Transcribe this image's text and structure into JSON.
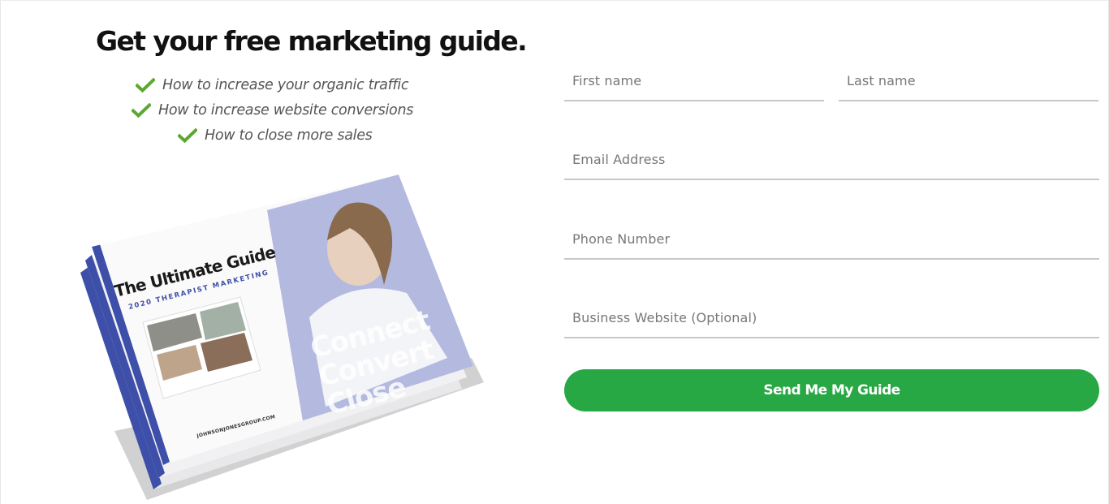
{
  "headline": "Get your free marketing guide.",
  "bullets": [
    "How to increase your organic traffic",
    "How to increase website conversions",
    "How to close more sales"
  ],
  "guide": {
    "title": "The Ultimate Guide",
    "subtitle": "2020 THERAPIST MARKETING",
    "website": "JOHNSONJONESGROUP.COM",
    "tagline": [
      "Connect",
      "Convert",
      "Close"
    ]
  },
  "form": {
    "first_name_placeholder": "First name",
    "last_name_placeholder": "Last name",
    "email_placeholder": "Email Address",
    "phone_placeholder": "Phone Number",
    "website_placeholder": "Business Website (Optional)",
    "submit_label": "Send Me My Guide"
  },
  "colors": {
    "accent_green": "#27a844",
    "check_green": "#5aa832",
    "guide_blue": "#3d4fa8",
    "guide_lavender": "#b3b9df"
  },
  "icons": {
    "check": "check-icon"
  }
}
